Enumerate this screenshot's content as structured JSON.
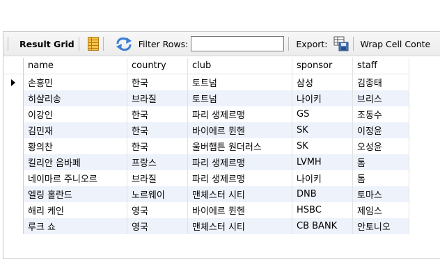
{
  "toolbar": {
    "title": "Result Grid",
    "filter_label": "Filter Rows:",
    "filter_value": "",
    "export_label": "Export:",
    "wrap_label": "Wrap Cell Conte"
  },
  "grid": {
    "columns": [
      "name",
      "country",
      "club",
      "sponsor",
      "staff"
    ],
    "rows": [
      [
        "손흥민",
        "한국",
        "토트넘",
        "삼성",
        "김종태"
      ],
      [
        "히샬리송",
        "브라질",
        "토트넘",
        "나이키",
        "브리스"
      ],
      [
        "이강인",
        "한국",
        "파리 생제르맹",
        "GS",
        "조동수"
      ],
      [
        "김민재",
        "한국",
        "바이에르 뮌헨",
        "SK",
        "이정윤"
      ],
      [
        "황의찬",
        "한국",
        "울버햄튼 원더러스",
        "SK",
        "오성윤"
      ],
      [
        "킬리안 음바페",
        "프랑스",
        "파리 생제르맹",
        "LVMH",
        "톰"
      ],
      [
        "네이마르 주니오르",
        "브라질",
        "파리 생제르맹",
        "나이키",
        "톰"
      ],
      [
        "엘링 홀란드",
        "노르웨이",
        "맨체스터 시티",
        "DNB",
        "토마스"
      ],
      [
        "해리 케인",
        "영국",
        "바이에르 뮌헨",
        "HSBC",
        "제임스"
      ],
      [
        "루크 쇼",
        "영국",
        "맨체스터 시티",
        "CB BANK",
        "안토니오"
      ]
    ],
    "selected_row": 0
  },
  "colors": {
    "alt_row": "#eef2fb",
    "toolbar_bg": "#ececec"
  },
  "icons": [
    "grid-view-icon",
    "refresh-icon",
    "export-icon",
    "row-pointer-icon"
  ]
}
